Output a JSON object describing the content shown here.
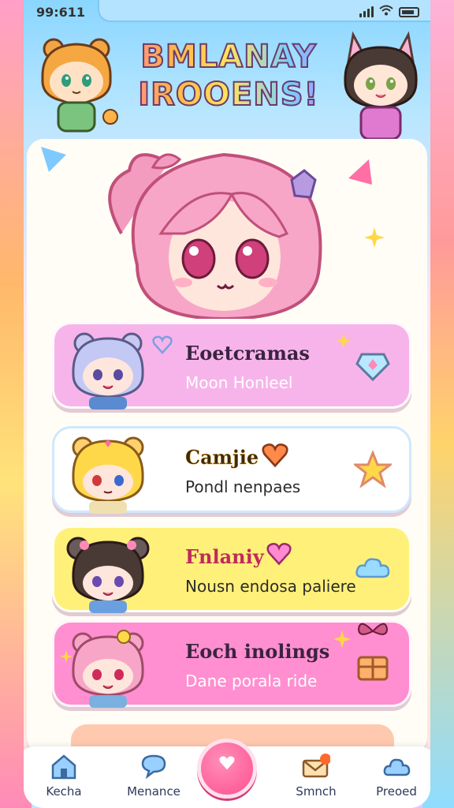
{
  "status_bar": {
    "time": "99:611"
  },
  "header": {
    "title_line1": "BMLANAY",
    "title_line2": "IROOENS!"
  },
  "items": [
    {
      "title": "Eoetcramas",
      "subtitle": "Moon Honleel",
      "bg": "#f7b4ea",
      "subtitle_color": "#ffffff",
      "deco_icon": "heart-diamond-icon"
    },
    {
      "title": "Camjie",
      "subtitle": "Pondl nenpaes",
      "bg": "#ffffff",
      "subtitle_color": "#2b2b2b",
      "deco_icon": "star-icon"
    },
    {
      "title": "Fnlaniy",
      "subtitle": "Nousn endosa paliere",
      "bg": "#fff07a",
      "subtitle_color": "#2b2b2b",
      "deco_icon": "cloud-icon"
    },
    {
      "title": "Eoch inolings",
      "subtitle": "Dane porala ride",
      "bg": "#ff8fd0",
      "subtitle_color": "#ffffff",
      "deco_icon": "gift-box-icon"
    }
  ],
  "nav": [
    {
      "label": "Kecha",
      "icon": "home-icon"
    },
    {
      "label": "Menance",
      "icon": "chat-bubble-icon"
    },
    {
      "label": "Smnch",
      "icon": "envelope-icon"
    },
    {
      "label": "Preoed",
      "icon": "cloud-icon"
    }
  ],
  "colors": {
    "accent_pink": "#ff4f8f",
    "title_outline": "#6b3b6b",
    "header_blue": "#8ad6ff"
  }
}
